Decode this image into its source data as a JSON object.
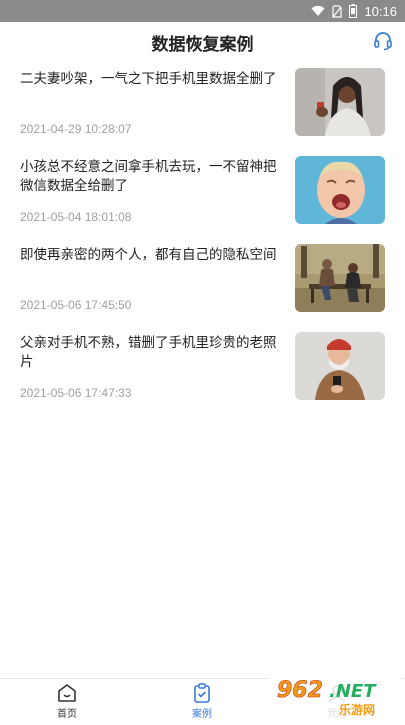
{
  "status_bar": {
    "time": "10:16"
  },
  "header": {
    "title": "数据恢复案例",
    "support_icon": "headset-icon"
  },
  "cases": [
    {
      "title": "二夫妻吵架，一气之下把手机里数据全删了",
      "date": "2021-04-29 10:28:07",
      "image": "woman-upset-phone-photo"
    },
    {
      "title": "小孩总不经意之间拿手机去玩，一不留神把微信数据全给删了",
      "date": "2021-05-04 18:01:08",
      "image": "crying-child-photo"
    },
    {
      "title": "即使再亲密的两个人，都有自己的隐私空间",
      "date": "2021-05-06 17:45:50",
      "image": "couple-bench-photo"
    },
    {
      "title": "父亲对手机不熟，错删了手机里珍贵的老照片",
      "date": "2021-05-06 17:47:33",
      "image": "old-man-phone-photo"
    }
  ],
  "tabbar": {
    "tabs": [
      {
        "label": "首页",
        "icon": "home-icon",
        "active": false
      },
      {
        "label": "案例",
        "icon": "clipboard-check-icon",
        "active": true
      },
      {
        "label": "我的",
        "icon": "user-icon",
        "active": false
      }
    ],
    "active_color": "#3a7bd5",
    "inactive_color": "#333333"
  },
  "watermark": {
    "text_top": "962.NET",
    "text_bottom": "乐游网"
  }
}
